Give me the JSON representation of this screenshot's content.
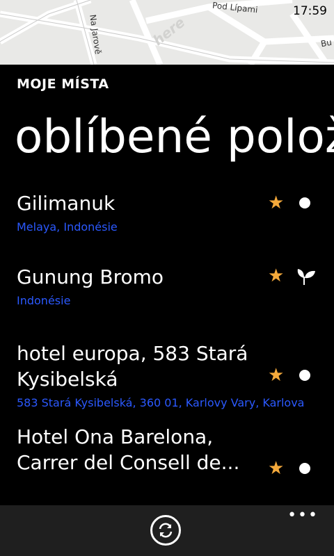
{
  "status": {
    "time": "17:59"
  },
  "map": {
    "streets": [
      "Pod Lípami",
      "Na Jarově",
      "Bu"
    ],
    "watermark": "here"
  },
  "header": {
    "app_title": "MOJE MÍSTA",
    "pivot_title": "oblíbené polož"
  },
  "favorites": [
    {
      "title": "Gilimanuk",
      "subtitle": "Melaya, Indonésie",
      "icon": "dot-icon"
    },
    {
      "title": "Gunung Bromo",
      "subtitle": "Indonésie",
      "icon": "leaf-icon"
    },
    {
      "title": "hotel europa, 583 Stará Kysibelská",
      "subtitle": "583 Stará Kysibelská, 360 01, Karlovy Vary, Karlova",
      "icon": "dot-icon"
    },
    {
      "title": "Hotel Ona Barelona, Carrer del Consell de...",
      "subtitle": "",
      "icon": "dot-icon"
    }
  ],
  "appbar": {
    "more": "•••",
    "primary_action_icon": "sync-icon"
  },
  "colors": {
    "accent_link": "#2b59ff",
    "star": "#f4a93b",
    "background": "#000000",
    "appbar": "#1f1f1f"
  }
}
